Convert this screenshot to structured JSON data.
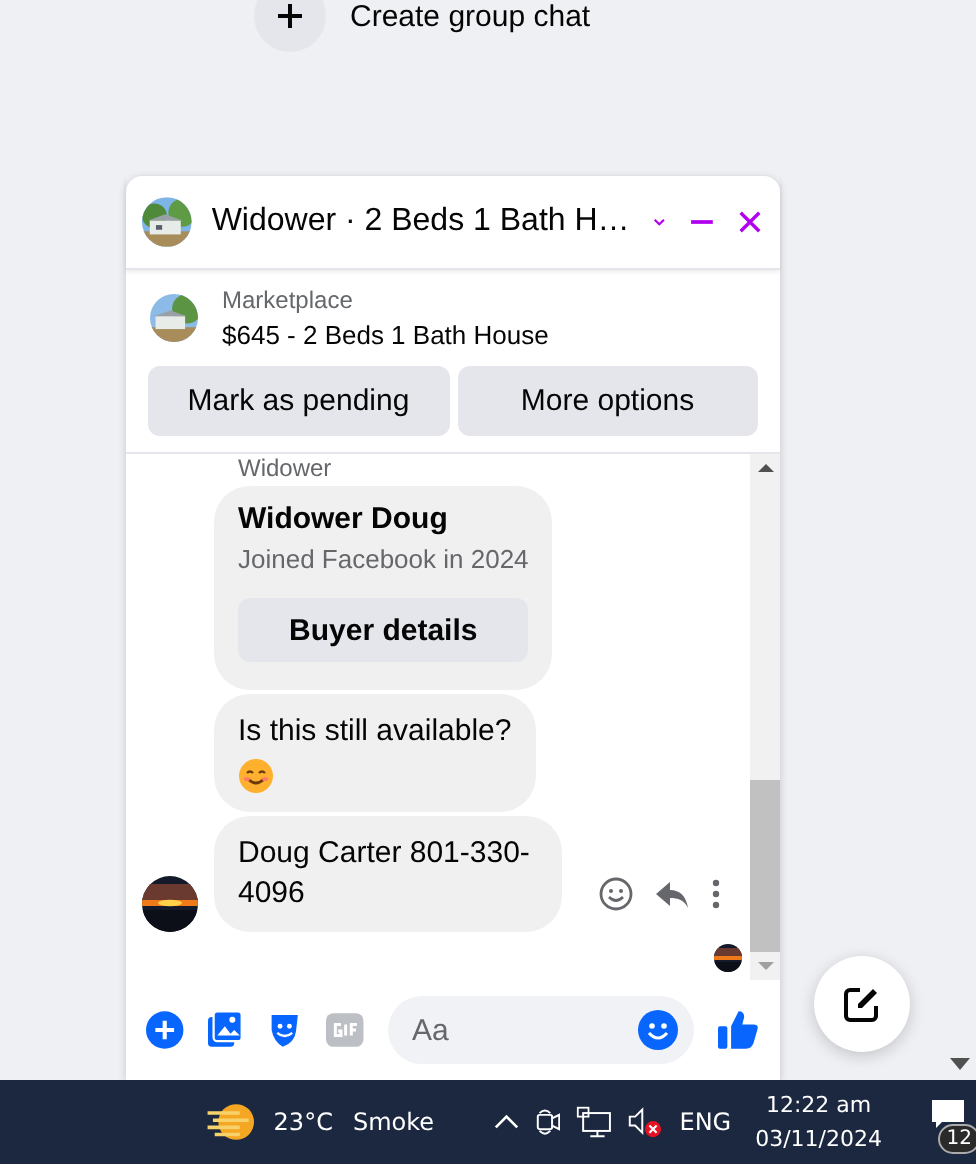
{
  "background_list": {
    "create_group_chat": "Create group chat"
  },
  "chat": {
    "title": "Widower · 2 Beds 1 Bath H…",
    "listing": {
      "source": "Marketplace",
      "title": "$645 - 2 Beds 1 Bath House"
    },
    "actions": [
      "Mark as pending",
      "More options"
    ],
    "messages": [
      {
        "kind": "sender_name",
        "text": "Widower"
      },
      {
        "kind": "profile_card",
        "name": "Widower Doug",
        "subtitle": "Joined Facebook in 2024",
        "button": "Buyer details"
      },
      {
        "kind": "text",
        "text": "Is this still available?",
        "emoji": true,
        "avatar": false,
        "hovered": false
      },
      {
        "kind": "text",
        "text": "Doug Carter 801-330-4096",
        "emoji": false,
        "avatar": true,
        "hovered": true
      }
    ],
    "composer": {
      "placeholder": "Aa"
    }
  },
  "taskbar": {
    "temperature": "23°C",
    "weather": "Smoke",
    "language": "ENG",
    "time": "12:22 am",
    "date": "03/11/2024",
    "notifications": "12"
  }
}
